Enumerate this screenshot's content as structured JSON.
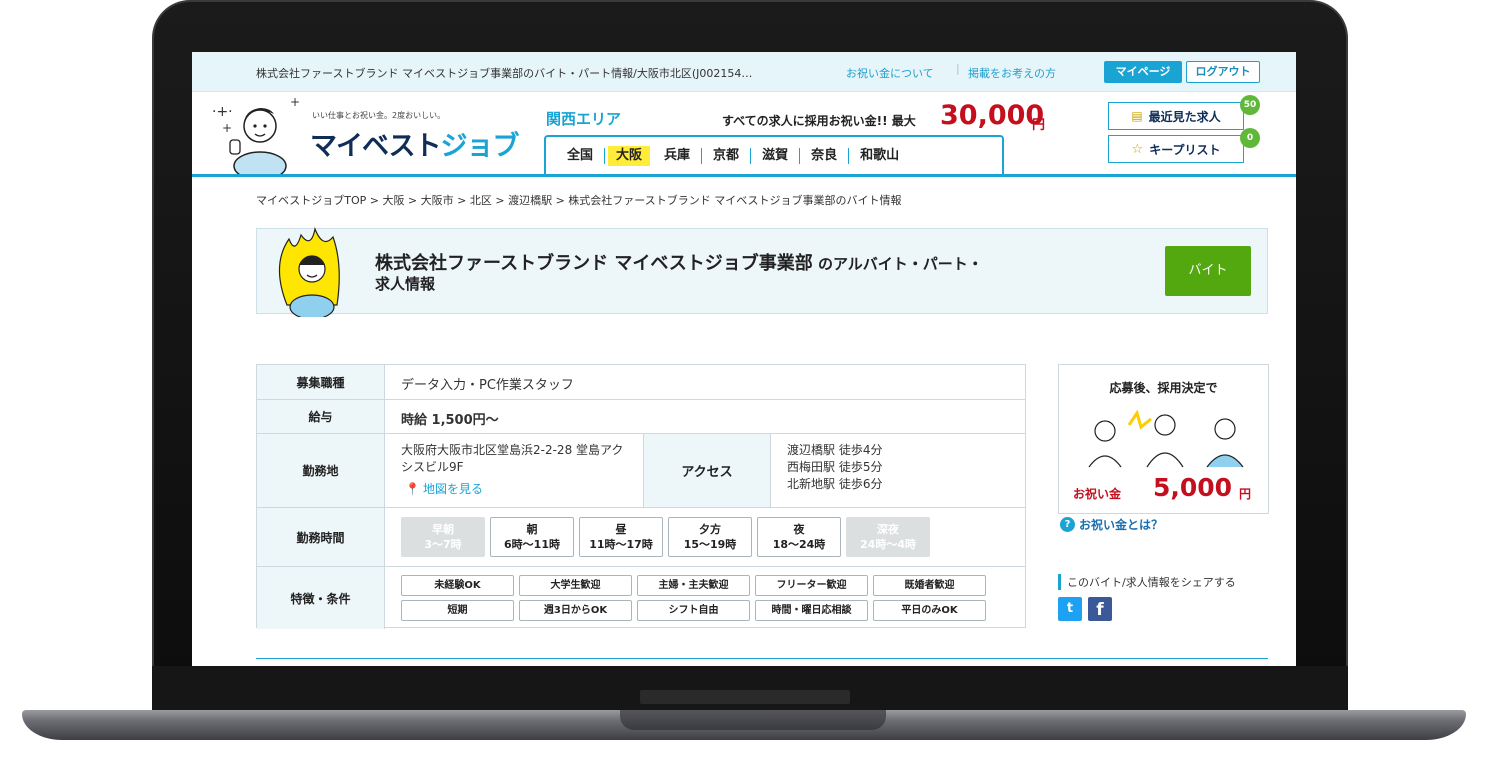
{
  "topbar": {
    "page_title": "株式会社ファーストブランド マイベストジョブ事業部のバイト・パート情報/大阪市北区(J002154…",
    "link_celebration": "お祝い金について",
    "link_listing": "掲載をお考えの方",
    "mypage_label": "マイページ",
    "logout_label": "ログアウト"
  },
  "header": {
    "logo_tagline": "いい仕事とお祝い金。2度おいしい。",
    "logo_main": "マイベスト",
    "logo_accent": "ジョブ",
    "region": "関西エリア",
    "banner_text": "すべての求人に採用お祝い金!! 最大",
    "banner_amount": "30,000",
    "banner_yen": "円",
    "prefectures": [
      "全国",
      "大阪",
      "兵庫",
      "京都",
      "滋賀",
      "奈良",
      "和歌山"
    ],
    "active_prefecture": "大阪",
    "recent_label": "最近見た求人",
    "recent_count": "50",
    "keep_label": "キープリスト",
    "keep_count": "0"
  },
  "breadcrumb": "マイベストジョブTOP > 大阪 > 大阪市 > 北区 > 渡辺橋駅 > 株式会社ファーストブランド マイベストジョブ事業部のバイト情報",
  "company": {
    "name": "株式会社ファーストブランド マイベストジョブ事業部",
    "suffix": " のアルバイト・パート・",
    "line2": "求人情報",
    "type_button": "バイト"
  },
  "details": {
    "job_type_label": "募集職種",
    "job_type": "データ入力・PC作業スタッフ",
    "salary_label": "給与",
    "salary": "時給 1,500円〜",
    "location_label": "勤務地",
    "address": "大阪府大阪市北区堂島浜2-2-28 堂島アクシスビル9F",
    "map_link": "地図を見る",
    "access_label": "アクセス",
    "access": [
      "渡辺橋駅 徒歩4分",
      "西梅田駅 徒歩5分",
      "北新地駅 徒歩6分"
    ],
    "hours_label": "勤務時間",
    "time_slots": [
      {
        "name": "早朝",
        "range": "3〜7時",
        "available": false
      },
      {
        "name": "朝",
        "range": "6時〜11時",
        "available": true
      },
      {
        "name": "昼",
        "range": "11時〜17時",
        "available": true
      },
      {
        "name": "夕方",
        "range": "15〜19時",
        "available": true
      },
      {
        "name": "夜",
        "range": "18〜24時",
        "available": true
      },
      {
        "name": "深夜",
        "range": "24時〜4時",
        "available": false
      }
    ],
    "features_label": "特徴・条件",
    "features": [
      "未経験OK",
      "大学生歓迎",
      "主婦・主夫歓迎",
      "フリーター歓迎",
      "既婚者歓迎",
      "短期",
      "週3日からOK",
      "シフト自由",
      "時間・曜日応相談",
      "平日のみOK"
    ]
  },
  "celebration": {
    "title": "応募後、採用決定で",
    "label": "お祝い金",
    "amount": "5,000",
    "yen": "円",
    "what_link": "お祝い金とは？"
  },
  "share": {
    "label": "このバイト/求人情報をシェアする"
  },
  "colors": {
    "accent": "#1aa4d4",
    "money": "#c40f1f",
    "button_green": "#54a80f",
    "highlight": "#ffec3a"
  }
}
